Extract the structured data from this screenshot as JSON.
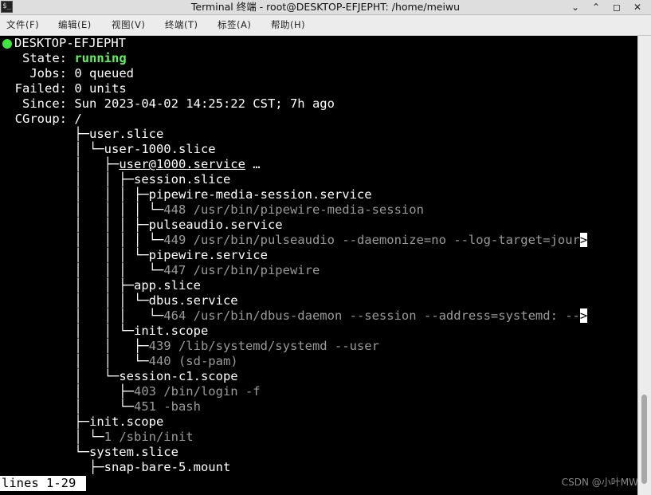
{
  "window": {
    "title": "Terminal 终端 - root@DESKTOP-EFJEPHT: /home/meiwu",
    "controls": [
      "⌄",
      "⌃",
      "◻",
      "✕"
    ]
  },
  "menu": [
    "文件(F)",
    "编辑(E)",
    "视图(V)",
    "终端(T)",
    "标签(A)",
    "帮助(H)"
  ],
  "terminal": {
    "host": "DESKTOP-EFJEPHT",
    "status": [
      {
        "label": "   State: ",
        "value": "running"
      },
      {
        "label": "    Jobs: ",
        "value": "0 queued"
      },
      {
        "label": "  Failed: ",
        "value": "0 units"
      },
      {
        "label": "   Since: ",
        "value": "Sun 2023-04-02 14:25:22 CST; 7h ago"
      },
      {
        "label": "  CGroup: ",
        "value": "/"
      }
    ],
    "tree": [
      {
        "prefix": "          ├─",
        "text": "user.slice",
        "dim": ""
      },
      {
        "prefix": "          │ └─",
        "text": "user-1000.slice",
        "dim": ""
      },
      {
        "prefix": "          │   ├─",
        "text": "user@1000.service",
        "dim": "",
        "suffix": " …"
      },
      {
        "prefix": "          │   │ ├─",
        "text": "session.slice",
        "dim": ""
      },
      {
        "prefix": "          │   │ │ ├─",
        "text": "pipewire-media-session.service",
        "dim": ""
      },
      {
        "prefix": "          │   │ │ │ └─",
        "text": "",
        "dim": "448 /usr/bin/pipewire-media-session"
      },
      {
        "prefix": "          │   │ │ ├─",
        "text": "pulseaudio.service",
        "dim": ""
      },
      {
        "prefix": "          │   │ │ │ └─",
        "text": "",
        "dim": "449 /usr/bin/pulseaudio --daemonize=no --log-target=jour"
      },
      {
        "prefix": "          │   │ │ └─",
        "text": "pipewire.service",
        "dim": ""
      },
      {
        "prefix": "          │   │ │   └─",
        "text": "",
        "dim": "447 /usr/bin/pipewire"
      },
      {
        "prefix": "          │   │ ├─",
        "text": "app.slice",
        "dim": ""
      },
      {
        "prefix": "          │   │ │ └─",
        "text": "dbus.service",
        "dim": ""
      },
      {
        "prefix": "          │   │ │   └─",
        "text": "",
        "dim": "464 /usr/bin/dbus-daemon --session --address=systemd: --"
      },
      {
        "prefix": "          │   │ └─",
        "text": "init.scope",
        "dim": ""
      },
      {
        "prefix": "          │   │   ├─",
        "text": "",
        "dim": "439 /lib/systemd/systemd --user"
      },
      {
        "prefix": "          │   │   └─",
        "text": "",
        "dim": "440 (sd-pam)"
      },
      {
        "prefix": "          │   └─",
        "text": "session-c1.scope",
        "dim": ""
      },
      {
        "prefix": "          │     ├─",
        "text": "",
        "dim": "403 /bin/login -f"
      },
      {
        "prefix": "          │     └─",
        "text": "",
        "dim": "451 -bash"
      },
      {
        "prefix": "          ├─",
        "text": "init.scope",
        "dim": ""
      },
      {
        "prefix": "          │ └─",
        "text": "",
        "dim": "1 /sbin/init"
      },
      {
        "prefix": "          └─",
        "text": "system.slice",
        "dim": ""
      },
      {
        "prefix": "            ├─",
        "text": "snap-bare-5.mount",
        "dim": ""
      }
    ],
    "overflow_marker": ">",
    "pager_status": "lines 1-29 "
  },
  "watermark": "CSDN @小叶MW",
  "colors": {
    "status_green": "#5ef35e",
    "dim_text": "#9a9a9a",
    "background": "#000000"
  }
}
